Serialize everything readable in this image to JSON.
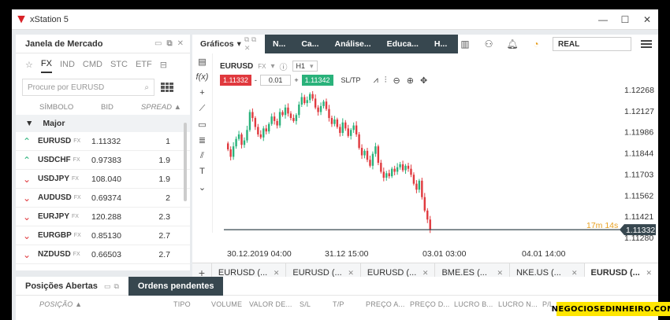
{
  "window": {
    "title": "xStation 5",
    "min_icon": "minimize-icon",
    "max_icon": "maximize-icon",
    "close_icon": "close-icon"
  },
  "market_panel": {
    "title": "Janela de Mercado",
    "tabs": [
      "FX",
      "IND",
      "CMD",
      "STC",
      "ETF"
    ],
    "active_tab": "FX",
    "search_placeholder": "Procure por EURUSD",
    "columns": {
      "symbol": "SÍMBOLO",
      "bid": "BID",
      "spread": "SPREAD ▲"
    },
    "group": "Major",
    "rows": [
      {
        "symbol": "EURUSD",
        "tag": "FX",
        "bid": "1.11332",
        "spread": "1",
        "dir": "up"
      },
      {
        "symbol": "USDCHF",
        "tag": "FX",
        "bid": "0.97383",
        "spread": "1.9",
        "dir": "up"
      },
      {
        "symbol": "USDJPY",
        "tag": "FX",
        "bid": "108.040",
        "spread": "1.9",
        "dir": "down"
      },
      {
        "symbol": "AUDUSD",
        "tag": "FX",
        "bid": "0.69374",
        "spread": "2",
        "dir": "down"
      },
      {
        "symbol": "EURJPY",
        "tag": "FX",
        "bid": "120.288",
        "spread": "2.3",
        "dir": "down"
      },
      {
        "symbol": "EURGBP",
        "tag": "FX",
        "bid": "0.85130",
        "spread": "2.7",
        "dir": "down"
      },
      {
        "symbol": "NZDUSD",
        "tag": "FX",
        "bid": "0.66503",
        "spread": "2.7",
        "dir": "down"
      }
    ]
  },
  "chart_panel": {
    "title": "Gráficos",
    "top_tabs": [
      "N...",
      "Ca...",
      "Análise...",
      "Educa...",
      "H..."
    ],
    "account_mode": "REAL",
    "symbol": "EURUSD",
    "symbol_tag": "FX",
    "timeframe": "H1",
    "sell_price": "1.11332",
    "volume": "0.01",
    "buy_price": "1.11342",
    "sltp_label": "SL/TP",
    "countdown": "17m 14s",
    "bottom_tabs": [
      "EURUSD (...",
      "EURUSD (...",
      "EURUSD (...",
      "BME.ES (...",
      "NKE.US (...",
      "EURUSD (..."
    ],
    "active_bottom_tab": 5
  },
  "chart_data": {
    "type": "candlestick",
    "symbol": "EURUSD",
    "timeframe": "H1",
    "y_ticks": [
      "1.12268",
      "1.12127",
      "1.11986",
      "1.11844",
      "1.11703",
      "1.11562",
      "1.11421",
      "1.11280"
    ],
    "x_ticks": [
      "30.12.2019 04:00",
      "31.12 15:00",
      "03.01 03:00",
      "04.01 14:00"
    ],
    "ylim": [
      1.1128,
      1.1227
    ],
    "current_price": "1.11332",
    "current_price_value": 1.11332,
    "close_series": [
      1.1187,
      1.1182,
      1.1189,
      1.1194,
      1.1197,
      1.119,
      1.1193,
      1.12,
      1.1212,
      1.1208,
      1.1202,
      1.1197,
      1.1195,
      1.1201,
      1.1199,
      1.1204,
      1.1209,
      1.1206,
      1.1203,
      1.1212,
      1.121,
      1.1215,
      1.1211,
      1.1208,
      1.1206,
      1.121,
      1.1217,
      1.1222,
      1.1218,
      1.122,
      1.1224,
      1.1221,
      1.1215,
      1.1212,
      1.1216,
      1.1219,
      1.1214,
      1.1208,
      1.1204,
      1.1207,
      1.1202,
      1.1198,
      1.1205,
      1.1201,
      1.1196,
      1.12,
      1.1203,
      1.1197,
      1.1188,
      1.1183,
      1.1186,
      1.118,
      1.1176,
      1.1184,
      1.1189,
      1.1178,
      1.1172,
      1.1168,
      1.1171,
      1.1169,
      1.1174,
      1.1172,
      1.1175,
      1.1177,
      1.1173,
      1.1176,
      1.1174,
      1.117,
      1.1164,
      1.116,
      1.1166,
      1.1155,
      1.1146,
      1.114,
      1.1133
    ]
  },
  "positions_panel": {
    "tab_open": "Posições Abertas",
    "tab_pending": "Ordens pendentes",
    "columns": [
      "POSIÇÃO ▲",
      "TIPO",
      "VOLUME",
      "VALOR DE...",
      "S/L",
      "T/P",
      "PREÇO A...",
      "PREÇO D...",
      "LUCRO B...",
      "LUCRO N...",
      "P/L"
    ]
  },
  "watermark": "NEGOCIOSEDINHEIRO.COM",
  "colors": {
    "up": "#2ab27b",
    "down": "#e0393e",
    "header_dark": "#37474f",
    "watermark_bg": "#ffe600"
  }
}
